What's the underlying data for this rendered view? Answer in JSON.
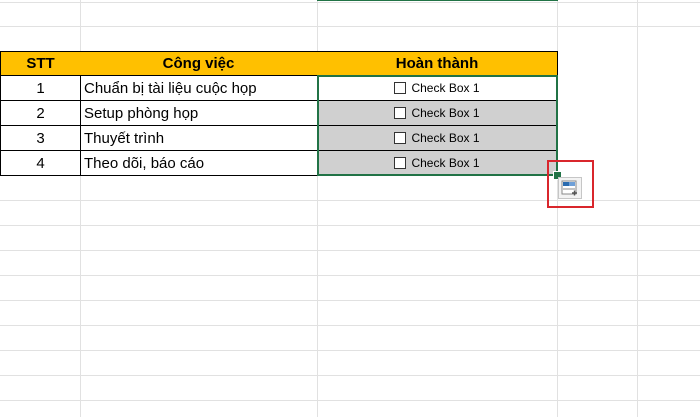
{
  "table": {
    "headers": {
      "stt": "STT",
      "task": "Công việc",
      "done": "Hoàn thành"
    },
    "rows": [
      {
        "stt": "1",
        "task": "Chuẩn bị tài liệu cuộc họp",
        "checkbox_label": "Check Box 1",
        "checked": false,
        "selected_fill": false
      },
      {
        "stt": "2",
        "task": "Setup phòng họp",
        "checkbox_label": "Check Box 1",
        "checked": false,
        "selected_fill": true
      },
      {
        "stt": "3",
        "task": "Thuyết trình",
        "checkbox_label": "Check Box 1",
        "checked": false,
        "selected_fill": true
      },
      {
        "stt": "4",
        "task": "Theo dõi, báo cáo",
        "checkbox_label": "Check Box 1",
        "checked": false,
        "selected_fill": true
      }
    ]
  },
  "colors": {
    "header_fill": "#ffc000",
    "selection_border": "#217346",
    "highlight_box": "#d9262c",
    "selected_cell_fill": "#d0d0d0"
  },
  "quick_analysis": {
    "icon": "quick-analysis-icon"
  }
}
